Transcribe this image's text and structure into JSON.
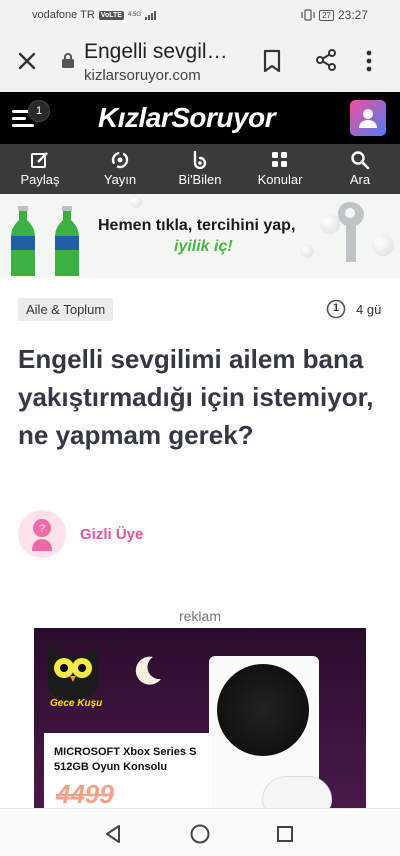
{
  "status_bar": {
    "carrier": "vodafone TR",
    "volte": "VoLTE",
    "network_type": "4.5G",
    "battery": "27",
    "time": "23:27"
  },
  "browser": {
    "page_title": "Engelli sevgil…",
    "url": "kizlarsoruyor.com"
  },
  "site_header": {
    "notification_count": "1",
    "logo_text": "KızlarSoruyor"
  },
  "nav": {
    "items": [
      {
        "label": "Paylaş",
        "icon": "pencil-icon"
      },
      {
        "label": "Yayın",
        "icon": "broadcast-icon"
      },
      {
        "label": "Bi'Bilen",
        "icon": "bibilen-icon"
      },
      {
        "label": "Konular",
        "icon": "grid-icon"
      },
      {
        "label": "Ara",
        "icon": "search-icon"
      }
    ]
  },
  "top_ad": {
    "line1": "Hemen tıkla, tercihini yap,",
    "line2": "iyilik iç!"
  },
  "question": {
    "category": "Aile & Toplum",
    "answer_count": "1",
    "time_ago": "4 gü",
    "title": "Engelli sevgilimi ailem bana yakıştırmadığı için istemiyor, ne yapmam gerek?",
    "author": "Gizli Üye"
  },
  "ad": {
    "label": "reklam",
    "brand": "Gece Kuşu",
    "product_name": "MICROSOFT Xbox Series S 512GB Oyun Konsolu",
    "old_price": "4499"
  },
  "colors": {
    "accent_pink": "#e0579a",
    "header_bg": "#000000",
    "nav_bg": "#3a3a3a",
    "title_text": "#333842"
  }
}
